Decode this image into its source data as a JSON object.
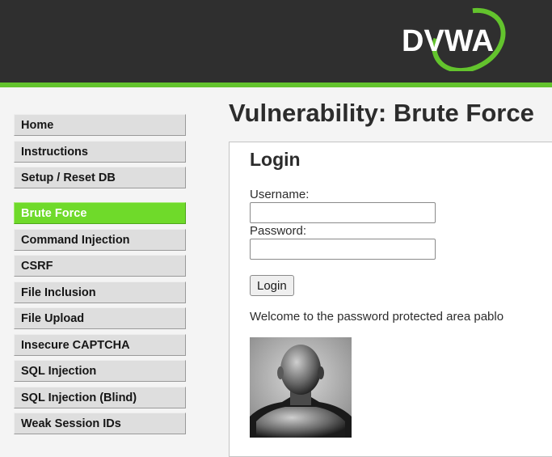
{
  "header": {
    "logo_text": "DVWA",
    "accent_color": "#63c32d"
  },
  "sidebar": {
    "groups": [
      {
        "items": [
          {
            "label": "Home"
          },
          {
            "label": "Instructions"
          },
          {
            "label": "Setup / Reset DB"
          }
        ]
      },
      {
        "items": [
          {
            "label": "Brute Force",
            "selected": true
          },
          {
            "label": "Command Injection"
          },
          {
            "label": "CSRF"
          },
          {
            "label": "File Inclusion"
          },
          {
            "label": "File Upload"
          },
          {
            "label": "Insecure CAPTCHA"
          },
          {
            "label": "SQL Injection"
          },
          {
            "label": "SQL Injection (Blind)"
          },
          {
            "label": "Weak Session IDs"
          }
        ]
      }
    ]
  },
  "main": {
    "title": "Vulnerability: Brute Force",
    "login_form": {
      "heading": "Login",
      "username_label": "Username:",
      "username_value": "",
      "password_label": "Password:",
      "password_value": "",
      "submit_label": "Login"
    },
    "welcome_message": "Welcome to the password protected area pablo",
    "user_image_icon": "user-photo"
  }
}
